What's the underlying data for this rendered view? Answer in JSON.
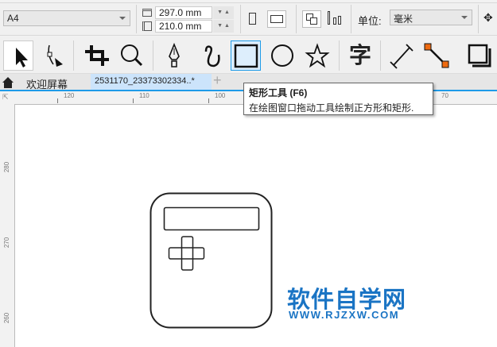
{
  "property_bar": {
    "page_size": "A4",
    "width": "297.0 mm",
    "height": "210.0 mm",
    "units_label": "单位:",
    "units_value": "毫米"
  },
  "toolbox": {
    "tools": [
      "pick-tool",
      "shape-tool",
      "crop-tool",
      "zoom-tool",
      "pen-tool",
      "freehand-tool",
      "rectangle-tool",
      "ellipse-tool",
      "polygon-tool",
      "text-tool",
      "dimension-tool",
      "connector-tool",
      "drop-shadow-tool"
    ],
    "active": "rectangle-tool",
    "accent": "#1e9be8"
  },
  "tabs": {
    "welcome": "欢迎屏幕",
    "document": "2531170_23373302334..*",
    "add": "+"
  },
  "tooltip": {
    "title": "矩形工具 (F6)",
    "body": "在绘图窗口拖动工具绘制正方形和矩形."
  },
  "rulers": {
    "horizontal": [
      "120",
      "110",
      "100",
      "70"
    ],
    "vertical": [
      "280",
      "270",
      "260"
    ]
  },
  "watermark": {
    "title": "软件自学网",
    "url": "WWW.RJZXW.COM",
    "color": "#1a74c4"
  }
}
